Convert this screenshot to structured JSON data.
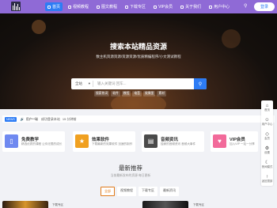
{
  "nav": {
    "items": [
      {
        "label": "首页",
        "active": true
      },
      {
        "label": "视频教程"
      },
      {
        "label": "图文教程"
      },
      {
        "label": "下载专区"
      },
      {
        "label": "VIP会员"
      },
      {
        "label": "关于我们"
      },
      {
        "label": "用户中心"
      }
    ],
    "search_icon": "search-icon",
    "login_label": "登录"
  },
  "hero": {
    "title": "搜索本站精品资源",
    "subtitle": "数主机资源资源/资源资源/优质精编程序/小文测试教程",
    "search": {
      "category": "全站",
      "placeholder": "输入关键词 回车...",
      "button_icon": "search-icon"
    },
    "hot_tags": [
      "搜索热词",
      "软件",
      "教程",
      "电音",
      "效果图",
      "素材"
    ]
  },
  "ticker": {
    "badge": "NEWS",
    "user": "用户**瑞",
    "action": "成功登录本站",
    "time": "15 分钟前"
  },
  "cards": [
    {
      "title": "免费教学",
      "desc": "精选优质的课程 让你无限的成长",
      "color": "#6f89f0",
      "icon": "📄"
    },
    {
      "title": "效果软件",
      "desc": "下载最新的效果软件 迅速的制作",
      "color": "#f0a020",
      "icon": "★"
    },
    {
      "title": "音频资讯",
      "desc": "独家的音频资讯 音频大事件",
      "color": "#4a4a4a",
      "icon": "▤"
    },
    {
      "title": "VIP会员",
      "desc": "加入VIP 一站一分享",
      "color": "#f26a9a",
      "icon": "♥"
    }
  ],
  "latest": {
    "title": "最新推荐",
    "subtitle": "当前最新发布的资源 每日更新",
    "tabs": [
      {
        "label": "全部",
        "active": true
      },
      {
        "label": "视频教程"
      },
      {
        "label": "下载专区"
      },
      {
        "label": "最新资讯"
      }
    ],
    "items": [
      {
        "label": "下载专区"
      },
      {
        "label": "下载专区"
      }
    ]
  },
  "sidebar": {
    "items": [
      {
        "icon": "home-icon",
        "glyph": "⌂",
        "label": "首页"
      },
      {
        "icon": "user-icon",
        "glyph": "☺",
        "label": "用户中心"
      },
      {
        "icon": "diamond-icon",
        "glyph": "◇",
        "label": "会员"
      },
      {
        "icon": "gear-icon",
        "glyph": "⚙",
        "label": "设置"
      },
      {
        "icon": "moon-icon",
        "glyph": "☾",
        "label": "夜间模式"
      },
      {
        "icon": "top-icon",
        "glyph": "↑",
        "label": "返回顶部"
      }
    ]
  },
  "colors": {
    "nav_bg": "#8f6ad6",
    "primary": "#2d7cf5",
    "accent": "#e07a1a"
  }
}
